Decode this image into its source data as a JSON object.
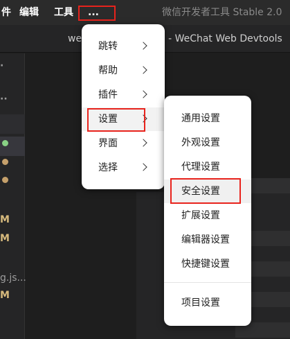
{
  "menubar": {
    "items": [
      {
        "label": "件"
      },
      {
        "label": "编辑"
      },
      {
        "label": "工具"
      }
    ],
    "more_label": "...",
    "app_title": "微信开发者工具 Stable 2.0"
  },
  "titlebar": {
    "doc_title_prefix": "we",
    "doc_title_suffix": "e - WeChat Web Devtools"
  },
  "sidebar": {
    "marker_1": "·",
    "marker_2": "··",
    "m1": "M",
    "m2": "M",
    "file_snippet": "g.js...",
    "m3": "M",
    "dot_colors": [
      "#89d185",
      "#c5a06b",
      "#c5a06b",
      "#c5a06b"
    ]
  },
  "main_menu": {
    "items": [
      {
        "label": "跳转",
        "has_submenu": true
      },
      {
        "label": "帮助",
        "has_submenu": true
      },
      {
        "label": "插件",
        "has_submenu": true
      },
      {
        "label": "设置",
        "has_submenu": true
      },
      {
        "label": "界面",
        "has_submenu": true
      },
      {
        "label": "选择",
        "has_submenu": true
      }
    ],
    "active_index": 3
  },
  "settings_submenu": {
    "items": [
      {
        "label": "通用设置"
      },
      {
        "label": "外观设置"
      },
      {
        "label": "代理设置"
      },
      {
        "label": "安全设置"
      },
      {
        "label": "扩展设置"
      },
      {
        "label": "编辑器设置"
      },
      {
        "label": "快捷键设置"
      },
      {
        "label": "项目设置"
      }
    ],
    "highlighted_index": 3
  },
  "colors": {
    "highlight_border": "#e8231c",
    "menu_bg": "#ffffff",
    "menubar_bg": "#2b2b2b",
    "editor_bg": "#1e1e1e"
  }
}
